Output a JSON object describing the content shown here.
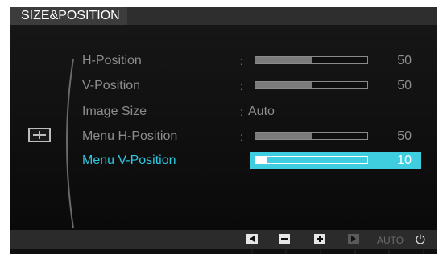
{
  "title": "SIZE&POSITION",
  "category_icon": "size-position-icon",
  "menu": [
    {
      "label": "H-Position",
      "type": "slider",
      "value": 50,
      "value_text": "50",
      "selected": false
    },
    {
      "label": "V-Position",
      "type": "slider",
      "value": 50,
      "value_text": "50",
      "selected": false
    },
    {
      "label": "Image Size",
      "type": "text",
      "value_text": "Auto",
      "selected": false
    },
    {
      "label": "Menu H-Position",
      "type": "slider",
      "value": 50,
      "value_text": "50",
      "selected": false
    },
    {
      "label": "Menu V-Position",
      "type": "slider",
      "value": 10,
      "value_text": "10",
      "selected": true
    }
  ],
  "separator": ":",
  "buttons": [
    {
      "name": "left-arrow-icon",
      "enabled": true
    },
    {
      "name": "minus-icon",
      "enabled": true
    },
    {
      "name": "plus-icon",
      "enabled": true
    },
    {
      "name": "play-icon",
      "enabled": false
    },
    {
      "name": "auto",
      "label": "AUTO",
      "enabled": false
    },
    {
      "name": "power-icon",
      "label": "⏻",
      "enabled": true
    }
  ],
  "colors": {
    "selected_text": "#2ec8e0",
    "highlight": "#3fcde0",
    "normal_text": "#8d8d8d"
  }
}
